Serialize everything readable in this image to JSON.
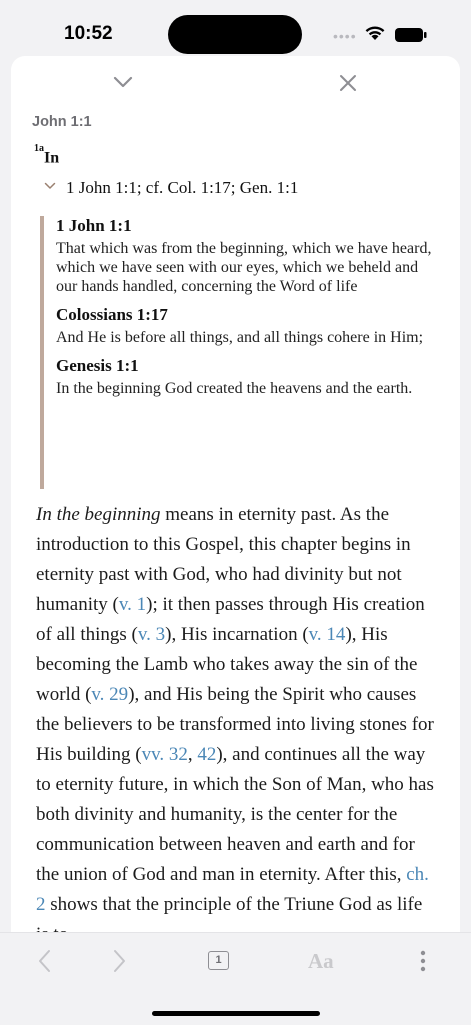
{
  "status": {
    "time": "10:52"
  },
  "sheet": {
    "reference": "John 1:1",
    "footnote_mark": "1a",
    "footnote_word": "In",
    "crossref_line": "1 John 1:1; cf. Col. 1:17; Gen. 1:1",
    "verses": [
      {
        "ref": "1 John 1:1",
        "text": "That which was from the beginning, which we have heard, which we have seen with our eyes, which we beheld and our hands handled, concerning the Word of life"
      },
      {
        "ref": "Colossians 1:17",
        "text": "And He is before all things, and all things cohere in Him;"
      },
      {
        "ref": "Genesis 1:1",
        "text": "In the beginning God created the heavens and the earth."
      }
    ],
    "note": {
      "italic_lead": "In the beginning",
      "p1": " means in eternity past. As the introduction to this Gospel, this chapter begins in eternity past with God, who had divinity but not humanity (",
      "l1": "v. 1",
      "p2": "); it then passes through His creation of all things (",
      "l2": "v. 3",
      "p3": "), His incarnation (",
      "l3": "v. 14",
      "p4": "), His becoming the Lamb who takes away the sin of the world (",
      "l4": "v. 29",
      "p5": "), and His being the Spirit who causes the believers to be transformed into living stones for His building (",
      "l5": "vv. 32",
      "p6": ", ",
      "l6": "42",
      "p7": "), and continues all the way to eternity future, in which the Son of Man, who has both divinity and humanity, is the center for the communication between heaven and earth and for the union of God and man in eternity. After this, ",
      "l7": "ch. 2",
      "p8": " shows that the principle of the Triune God as life is to"
    }
  },
  "toolbar": {
    "tabs_count": "1",
    "text_size_label": "Aa"
  },
  "colors": {
    "link": "#4b87b6",
    "quote_bar": "#bfa99c"
  }
}
